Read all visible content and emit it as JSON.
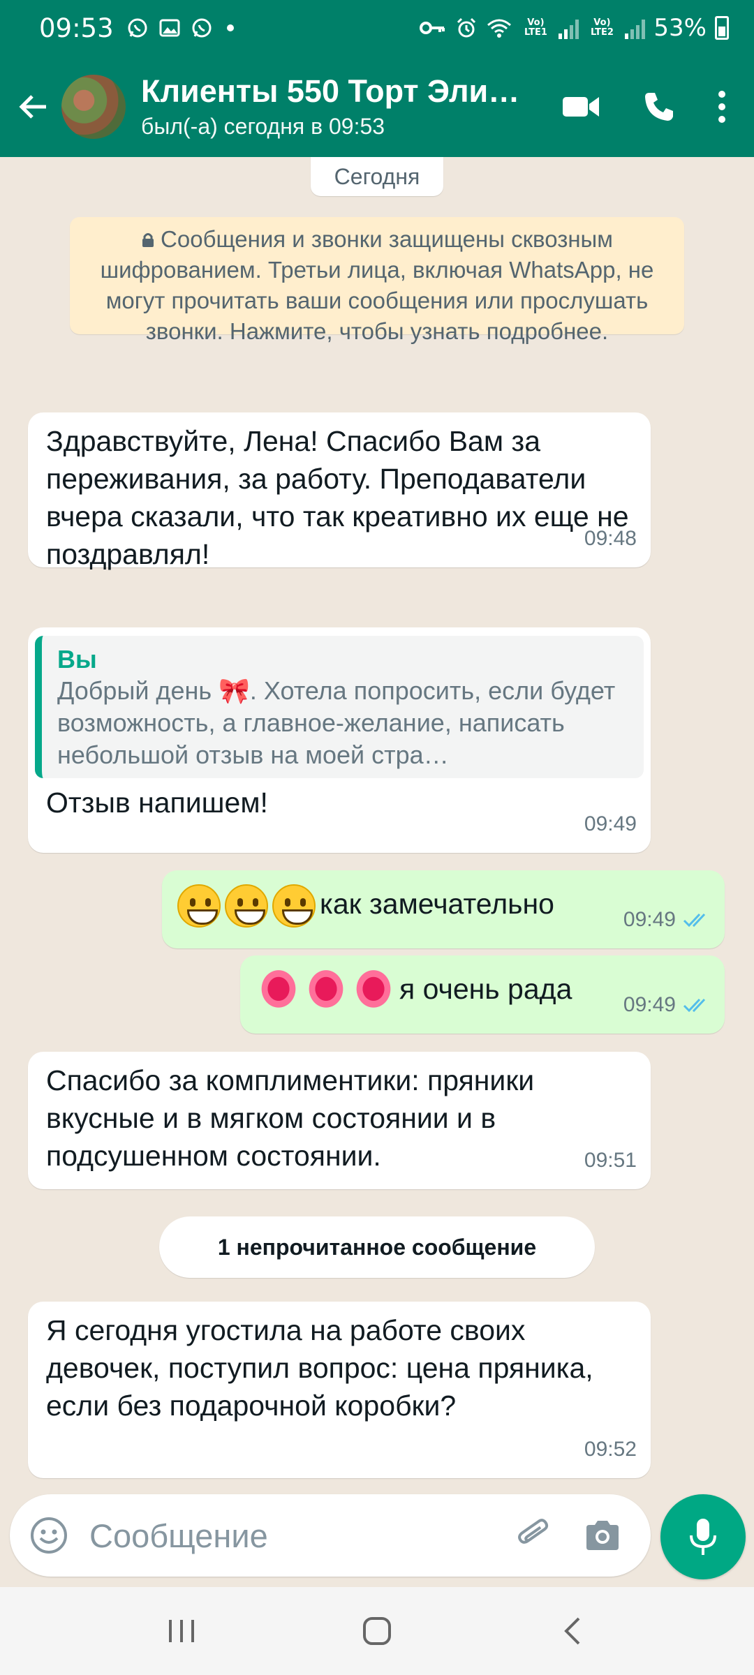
{
  "status_bar": {
    "time": "09:53",
    "battery": "53%",
    "sim1_label": "Vo) LTE1",
    "sim2_label": "Vo) LTE2"
  },
  "header": {
    "title": "Клиенты 550 Торт Эли…",
    "subtitle": "был(-а) сегодня в 09:53"
  },
  "chat": {
    "date_chip": "Сегодня",
    "encryption_notice": "Сообщения и звонки защищены сквозным шифрованием. Третьи лица, включая WhatsApp, не могут прочитать ваши сообщения или прослушать звонки. Нажмите, чтобы узнать подробнее.",
    "messages": [
      {
        "direction": "in",
        "text": "Здравствуйте, Лена! Спасибо Вам за переживания, за работу. Преподаватели вчера сказали, что так креативно их еще не поздравлял!",
        "time": "09:48"
      },
      {
        "direction": "in",
        "quote_author": "Вы",
        "quote_text": "Добрый день 🎀.  Хотела попросить,  если будет возможность,  а главное-желание, написать небольшой отзыв на моей стра…",
        "text": "Отзыв напишем!",
        "time": "09:49"
      },
      {
        "direction": "out",
        "emoji": "😅😀😅",
        "text": "как замечательно",
        "time": "09:49",
        "status": "read"
      },
      {
        "direction": "out",
        "emoji": "💋💋💋",
        "text": "я очень рада",
        "time": "09:49",
        "status": "read"
      },
      {
        "direction": "in",
        "text": "Спасибо за комплиментики: пряники вкусные и в мягком состоянии и в подсушенном состоянии.",
        "time": "09:51"
      },
      {
        "direction": "in",
        "text": "Я сегодня угостила на работе своих девочек, поступил вопрос: цена пряника, если без подарочной коробки?",
        "time": "09:52"
      }
    ],
    "unread_divider": "1 непрочитанное сообщение"
  },
  "composer": {
    "placeholder": "Сообщение"
  },
  "colors": {
    "brand": "#008069",
    "accent": "#00a884",
    "outgoing_bubble": "#d9fdd3",
    "chat_background": "#efe7dd",
    "read_ticks": "#53bdeb"
  }
}
